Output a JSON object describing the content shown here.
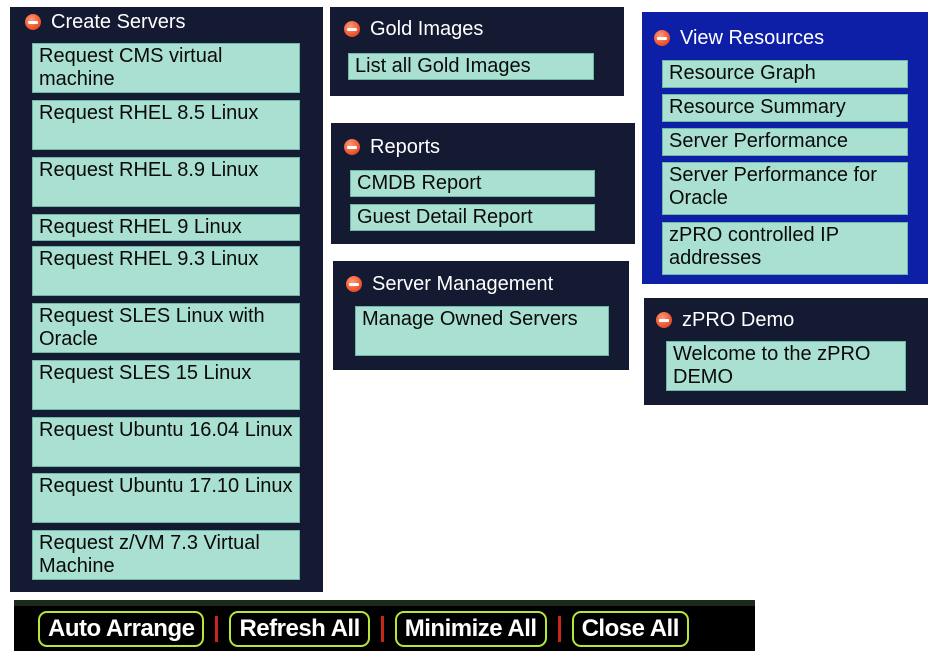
{
  "create_servers": {
    "title": "Create Servers",
    "items": [
      {
        "label": "Request CMS virtual machine"
      },
      {
        "label": "Request RHEL 8.5 Linux"
      },
      {
        "label": "Request RHEL 8.9 Linux"
      },
      {
        "label": "Request RHEL 9 Linux"
      },
      {
        "label": "Request RHEL 9.3 Linux"
      },
      {
        "label": "Request SLES Linux with Oracle"
      },
      {
        "label": "Request SLES 15 Linux"
      },
      {
        "label": "Request Ubuntu 16.04 Linux"
      },
      {
        "label": "Request Ubuntu 17.10 Linux"
      },
      {
        "label": "Request z/VM 7.3 Virtual Machine"
      }
    ]
  },
  "gold_images": {
    "title": "Gold Images",
    "items": [
      {
        "label": "List all Gold Images"
      }
    ]
  },
  "reports": {
    "title": "Reports",
    "items": [
      {
        "label": "CMDB Report"
      },
      {
        "label": "Guest Detail Report"
      }
    ]
  },
  "server_management": {
    "title": "Server Management",
    "items": [
      {
        "label": "Manage Owned Servers"
      }
    ]
  },
  "view_resources": {
    "title": "View Resources",
    "items": [
      {
        "label": "Resource Graph"
      },
      {
        "label": "Resource Summary"
      },
      {
        "label": "Server Performance"
      },
      {
        "label": "Server Performance for Oracle"
      },
      {
        "label": "zPRO controlled IP addresses"
      }
    ]
  },
  "zpro_demo": {
    "title": "zPRO Demo",
    "items": [
      {
        "label": "Welcome to the zPRO DEMO"
      }
    ]
  },
  "toolbar": {
    "auto_arrange": "Auto Arrange",
    "refresh_all": "Refresh All",
    "minimize_all": "Minimize All",
    "close_all": "Close All"
  },
  "colors": {
    "panel_bg": "#141a32",
    "panel_bg_blue": "#0d1fa6",
    "item_bg": "#a9e0d2",
    "minimize_icon": "#f0562e",
    "toolbar_border": "#b5e63a",
    "separator": "#c6261c"
  }
}
